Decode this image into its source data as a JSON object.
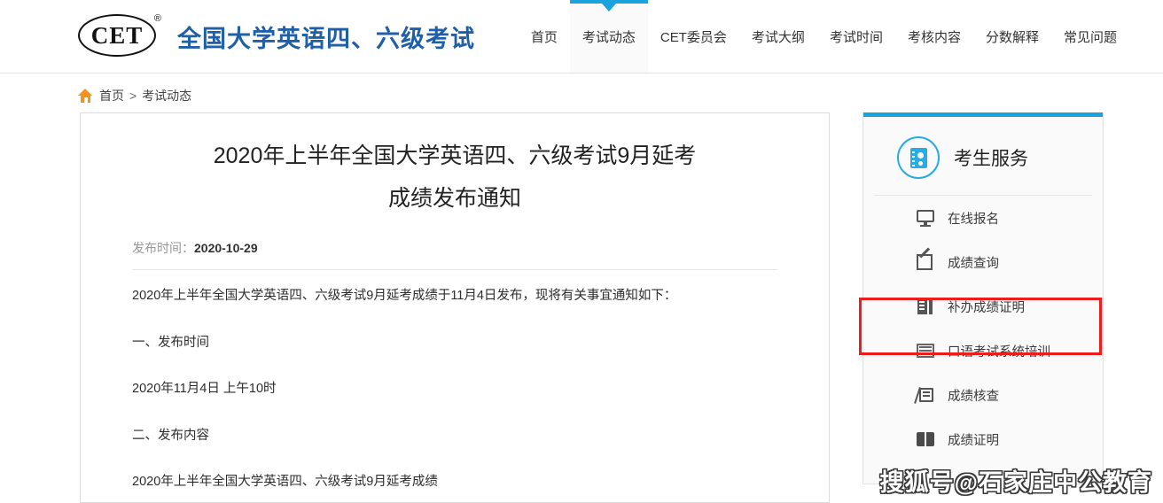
{
  "header": {
    "logo_text": "CET",
    "logo_registered": "®",
    "brand_title": "全国大学英语四、六级考试",
    "nav": [
      {
        "label": "首页",
        "active": false
      },
      {
        "label": "考试动态",
        "active": true
      },
      {
        "label": "CET委员会",
        "active": false
      },
      {
        "label": "考试大纲",
        "active": false
      },
      {
        "label": "考试时间",
        "active": false
      },
      {
        "label": "考核内容",
        "active": false
      },
      {
        "label": "分数解释",
        "active": false
      },
      {
        "label": "常见问题",
        "active": false
      }
    ]
  },
  "breadcrumb": {
    "home": "首页",
    "separator": ">",
    "current": "考试动态"
  },
  "article": {
    "title_line1": "2020年上半年全国大学英语四、六级考试9月延考",
    "title_line2": "成绩发布通知",
    "meta_label": "发布时间：",
    "meta_date": "2020-10-29",
    "paragraphs": [
      "2020年上半年全国大学英语四、六级考试9月延考成绩于11月4日发布，现将有关事宜通知如下：",
      "一、发布时间",
      "2020年11月4日 上午10时",
      "二、发布内容",
      "2020年上半年全国大学英语四、六级考试9月延考成绩"
    ]
  },
  "sidebar": {
    "title": "考生服务",
    "items": [
      {
        "label": "在线报名",
        "icon": "monitor-icon",
        "highlighted": false
      },
      {
        "label": "成绩查询",
        "icon": "edit-icon",
        "highlighted": false
      },
      {
        "label": "补办成绩证明",
        "icon": "certificate-icon",
        "highlighted": true
      },
      {
        "label": "口语考试系统培训",
        "icon": "oral-exam-icon",
        "highlighted": false
      },
      {
        "label": "成绩核查",
        "icon": "review-icon",
        "highlighted": false
      },
      {
        "label": "成绩证明",
        "icon": "book-icon",
        "highlighted": false
      }
    ]
  },
  "watermark": {
    "text": "搜狐号@石家庄中公教育"
  },
  "colors": {
    "accent_blue": "#1ca2dd",
    "brand_blue": "#1f5fa8",
    "home_orange": "#f6921e",
    "highlight_red": "#ee1c1c"
  }
}
